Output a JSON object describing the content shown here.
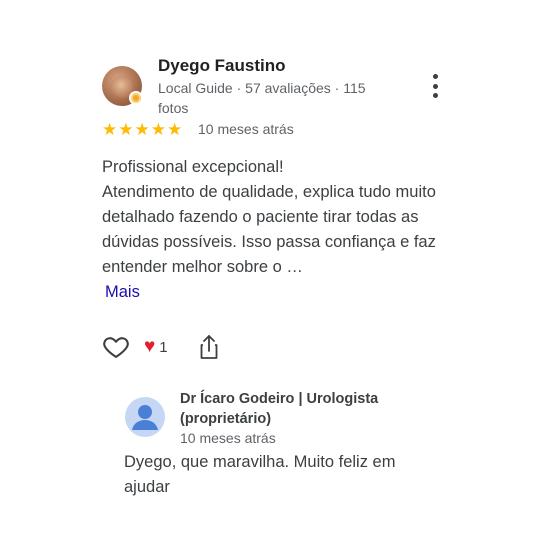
{
  "review": {
    "author": {
      "name": "Dyego Faustino",
      "meta": "Local Guide · 57 avaliações · 115 fotos",
      "avatar_icon": "user-photo",
      "badge_icon": "local-guide-badge"
    },
    "rating": 5,
    "rating_stars": [
      "★",
      "★",
      "★",
      "★",
      "★"
    ],
    "time_ago": "10 meses atrás",
    "text_lines": [
      "Profissional excepcional!",
      "Atendimento de qualidade, explica tudo muito detalhado fazendo o paciente tirar todas as dúvidas possíveis. Isso passa confiança e faz entender melhor sobre o …"
    ],
    "more_label": "Mais",
    "actions": {
      "like_icon": "heart-outline-icon",
      "reaction_icon": "heart-icon",
      "reaction_count": "1",
      "share_icon": "share-icon"
    }
  },
  "owner_response": {
    "name": "Dr Ícaro Godeiro | Urologista (proprietário)",
    "time_ago": "10 meses atrás",
    "text": "Dyego, que maravilha. Muito feliz em ajudar",
    "avatar_icon": "default-profile-icon"
  },
  "colors": {
    "star": "#fbbc04",
    "link": "#1a0dab",
    "heart": "#e0202c",
    "text": "#3c4043",
    "muted": "#5f6368"
  }
}
